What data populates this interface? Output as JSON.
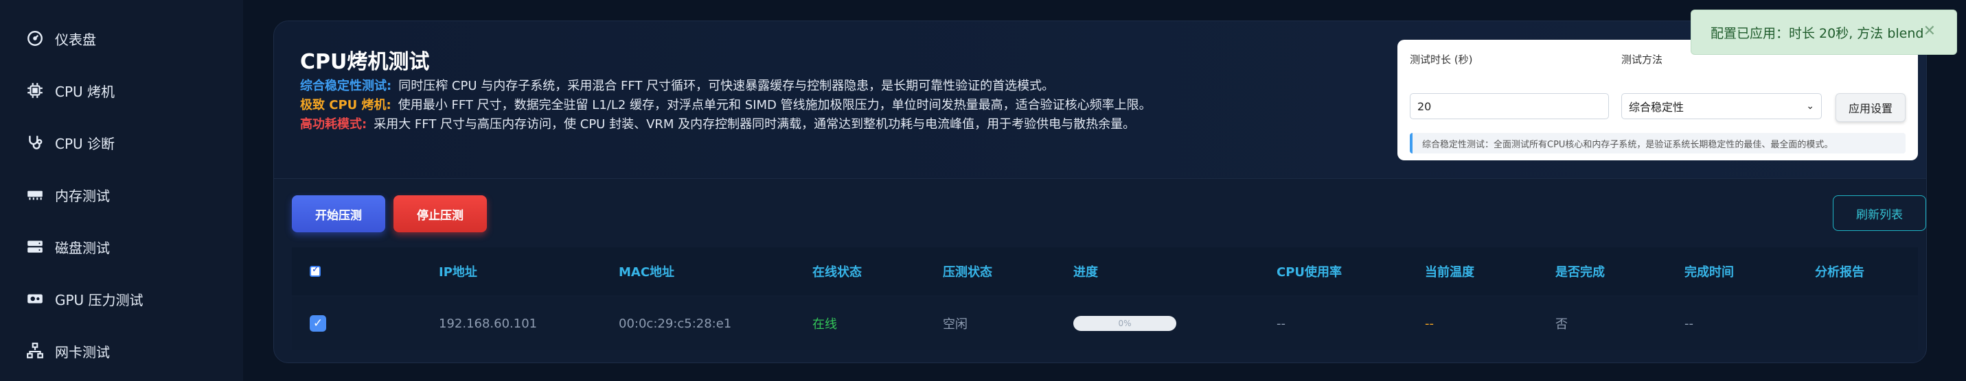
{
  "sidebar": {
    "items": [
      {
        "label": "仪表盘",
        "icon": "dashboard-icon"
      },
      {
        "label": "CPU 烤机",
        "icon": "cpu-chip-icon"
      },
      {
        "label": "CPU 诊断",
        "icon": "stethoscope-icon"
      },
      {
        "label": "内存测试",
        "icon": "memory-icon"
      },
      {
        "label": "磁盘测试",
        "icon": "hard-drive-icon"
      },
      {
        "label": "GPU 压力测试",
        "icon": "gpu-icon"
      },
      {
        "label": "网卡测试",
        "icon": "network-icon"
      }
    ]
  },
  "page": {
    "title": "CPU烤机测试",
    "modes": [
      {
        "tag": "综合稳定性测试:",
        "text": "同时压榨 CPU 与内存子系统，采用混合 FFT 尺寸循环，可快速暴露缓存与控制器隐患，是长期可靠性验证的首选模式。"
      },
      {
        "tag": "极致 CPU 烤机:",
        "text": "使用最小 FFT 尺寸，数据完全驻留 L1/L2 缓存，对浮点单元和 SIMD 管线施加极限压力，单位时间发热量最高，适合验证核心频率上限。"
      },
      {
        "tag": "高功耗模式:",
        "text": "采用大 FFT 尺寸与高压内存访问，使 CPU 封装、VRM 及内存控制器同时满载，通常达到整机功耗与电流峰值，用于考验供电与散热余量。"
      }
    ]
  },
  "settings": {
    "duration_label": "测试时长 (秒)",
    "duration_value": "20",
    "method_label": "测试方法",
    "method_value": "综合稳定性",
    "apply_label": "应用设置",
    "info": "综合稳定性测试：全面测试所有CPU核心和内存子系统，是验证系统长期稳定性的最佳、最全面的模式。"
  },
  "actions": {
    "start": "开始压测",
    "stop": "停止压测",
    "refresh": "刷新列表"
  },
  "table": {
    "headers": [
      "IP地址",
      "MAC地址",
      "在线状态",
      "压测状态",
      "进度",
      "CPU使用率",
      "当前温度",
      "是否完成",
      "完成时间",
      "分析报告"
    ],
    "rows": [
      {
        "ip": "192.168.60.101",
        "mac": "00:0c:29:c5:28:e1",
        "online": "在线",
        "stress": "空闲",
        "progress": 0,
        "progress_label": "0%",
        "cpu": "--",
        "temp": "--",
        "done": "否",
        "time": "--",
        "report": ""
      }
    ]
  },
  "toast": {
    "message": "配置已应用：时长 20秒, 方法 blend"
  },
  "colors": {
    "accent_blue": "#3d9cf0",
    "accent_orange": "#f5a623",
    "accent_red": "#ee4a4a",
    "online_green": "#34c759",
    "header_cyan": "#37b5e8"
  }
}
